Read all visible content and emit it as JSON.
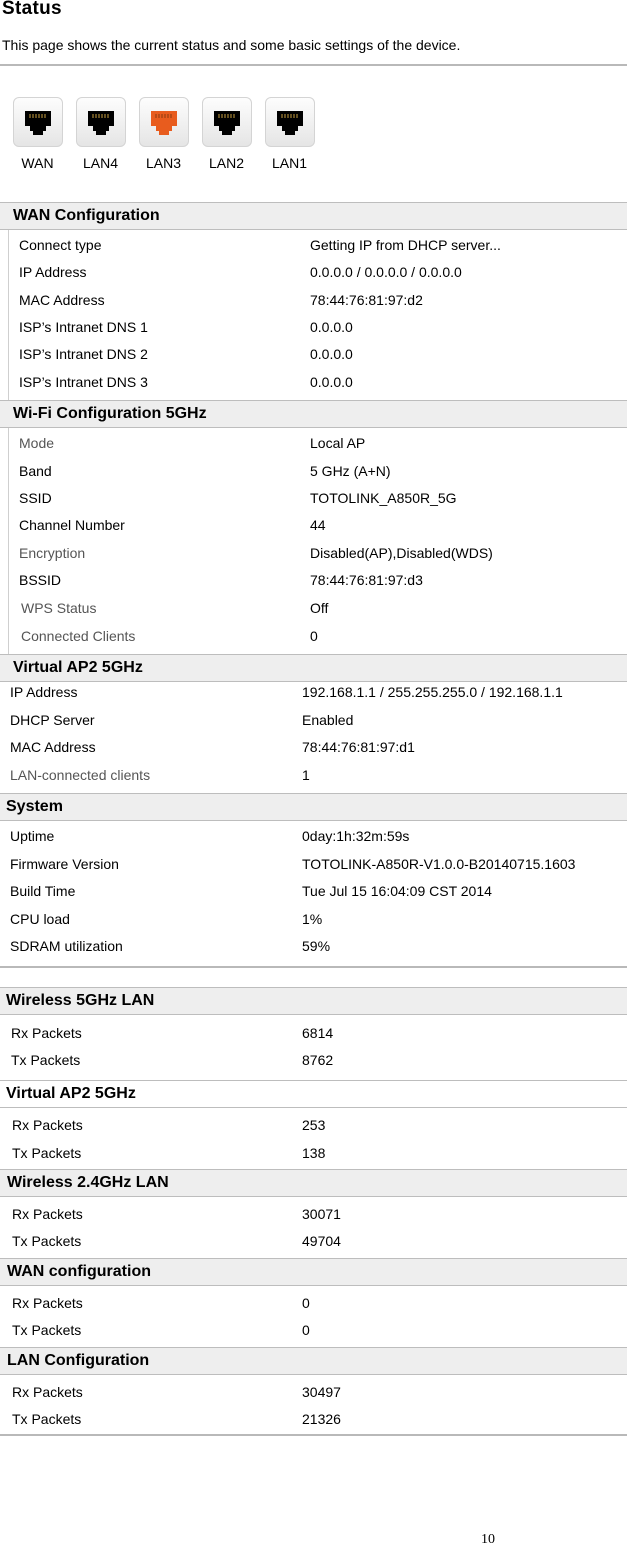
{
  "page": {
    "title": "Status",
    "description": "This page shows the current status and some basic settings of the device.",
    "page_number": "10"
  },
  "ports": [
    {
      "label": "WAN",
      "state": "inactive",
      "color": "#000000"
    },
    {
      "label": "LAN4",
      "state": "inactive",
      "color": "#000000"
    },
    {
      "label": "LAN3",
      "state": "active",
      "color": "#e85c1e"
    },
    {
      "label": "LAN2",
      "state": "inactive",
      "color": "#000000"
    },
    {
      "label": "LAN1",
      "state": "inactive",
      "color": "#000000"
    }
  ],
  "wan_config": {
    "header": "WAN Configuration",
    "rows": [
      {
        "label": "Connect type",
        "value": "Getting IP from DHCP server..."
      },
      {
        "label": "IP Address",
        "value": "0.0.0.0 / 0.0.0.0 / 0.0.0.0"
      },
      {
        "label": "MAC Address",
        "value": "78:44:76:81:97:d2"
      },
      {
        "label": "ISP’s Intranet DNS 1",
        "value": "0.0.0.0"
      },
      {
        "label": "ISP’s Intranet DNS 2",
        "value": "0.0.0.0"
      },
      {
        "label": "ISP’s Intranet DNS 3",
        "value": "0.0.0.0"
      }
    ]
  },
  "wifi_5g": {
    "header": "Wi-Fi Configuration 5GHz",
    "rows": [
      {
        "label": "Mode",
        "value": "Local AP"
      },
      {
        "label": "Band",
        "value": "5 GHz (A+N)"
      },
      {
        "label": "SSID",
        "value": "TOTOLINK_A850R_5G"
      },
      {
        "label": "Channel Number",
        "value": "44"
      },
      {
        "label": "Encryption",
        "value": "Disabled(AP),Disabled(WDS)"
      },
      {
        "label": "BSSID",
        "value": "78:44:76:81:97:d3"
      },
      {
        "label": "WPS Status",
        "value": "Off"
      },
      {
        "label": "Connected Clients",
        "value": "0"
      }
    ]
  },
  "vap2_5g": {
    "header": "Virtual AP2 5GHz",
    "rows": [
      {
        "label": "IP Address",
        "value": "192.168.1.1 / 255.255.255.0 / 192.168.1.1"
      },
      {
        "label": "DHCP Server",
        "value": "Enabled"
      },
      {
        "label": "MAC Address",
        "value": "78:44:76:81:97:d1"
      },
      {
        "label": "LAN-connected clients",
        "value": "1"
      }
    ]
  },
  "system": {
    "header": "System",
    "rows": [
      {
        "label": "Uptime",
        "value": "0day:1h:32m:59s"
      },
      {
        "label": "Firmware Version",
        "value": "TOTOLINK-A850R-V1.0.0-B20140715.1603"
      },
      {
        "label": "Build Time",
        "value": "Tue Jul 15 16:04:09 CST 2014"
      },
      {
        "label": "CPU load",
        "value": "1%"
      },
      {
        "label": "SDRAM utilization",
        "value": "59%"
      }
    ]
  },
  "stats": [
    {
      "header": "Wireless 5GHz LAN",
      "rx_label": "Rx Packets",
      "rx": "6814",
      "tx_label": "Tx Packets",
      "tx": "8762"
    },
    {
      "header": "Virtual AP2 5GHz",
      "rx_label": "Rx Packets",
      "rx": "253",
      "tx_label": "Tx Packets",
      "tx": "138"
    },
    {
      "header": "Wireless 2.4GHz LAN",
      "rx_label": "Rx Packets",
      "rx": "30071",
      "tx_label": "Tx Packets",
      "tx": "49704"
    },
    {
      "header": "WAN configuration",
      "rx_label": "Rx Packets",
      "rx": "0",
      "tx_label": "Tx Packets",
      "tx": "0"
    },
    {
      "header": "LAN Configuration",
      "rx_label": "Rx Packets",
      "rx": "30497",
      "tx_label": "Tx Packets",
      "tx": "21326"
    }
  ]
}
